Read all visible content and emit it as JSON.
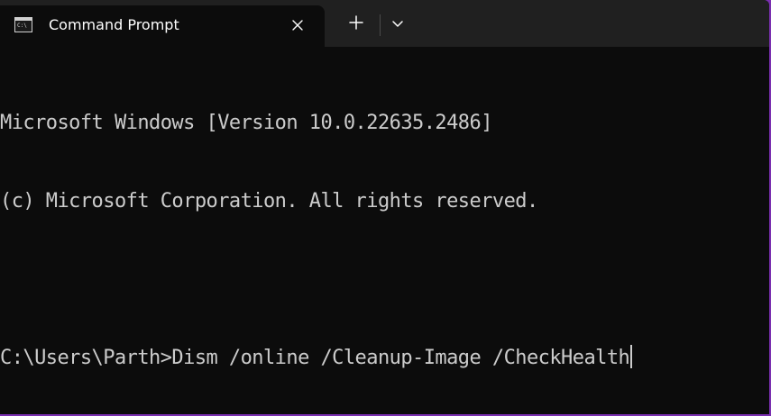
{
  "tab": {
    "title": "Command Prompt",
    "icon": "cmd-icon",
    "close_icon": "close-icon"
  },
  "toolbar": {
    "new_tab_icon": "plus-icon",
    "dropdown_icon": "chevron-down-icon"
  },
  "terminal": {
    "lines": [
      "Microsoft Windows [Version 10.0.22635.2486]",
      "(c) Microsoft Corporation. All rights reserved.",
      "",
      "C:\\Users\\Parth>Dism /online /Cleanup-Image /CheckHealth"
    ]
  },
  "colors": {
    "terminal_bg": "#0c0c0c",
    "tabbar_bg": "#202020",
    "text": "#cccccc",
    "border_accent": "#7a2fb0"
  }
}
